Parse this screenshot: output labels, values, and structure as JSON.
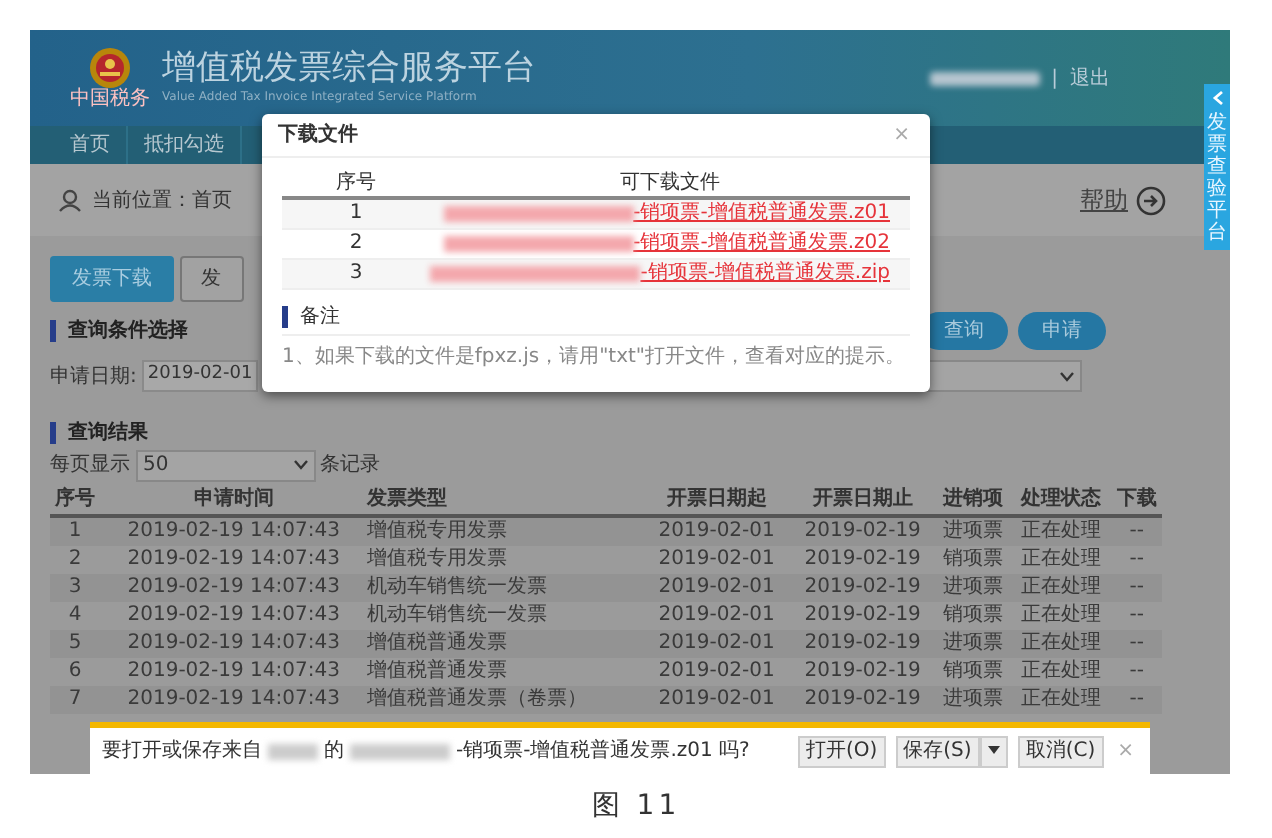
{
  "header": {
    "title": "增值税发票综合服务平台",
    "subtitle": "Value Added Tax Invoice Integrated Service Platform",
    "logo_text": "中国税务",
    "separator": "|",
    "logout": "退出"
  },
  "side_tab": {
    "label": "发票查验平台"
  },
  "nav": [
    {
      "label": "首页",
      "selected": false
    },
    {
      "label": "抵扣勾选",
      "selected": false
    }
  ],
  "breadcrumb": "当前位置：首页",
  "help": "帮助",
  "action_tabs": [
    {
      "label": "发票下载",
      "selected": true
    },
    {
      "label": "发",
      "selected": false
    }
  ],
  "query_section": {
    "title": "查询条件选择",
    "date_label": "申请日期:",
    "date_value": "2019-02-01",
    "buttons": [
      "查询",
      "申请"
    ]
  },
  "results": {
    "title": "查询结果",
    "page_size_label": "每页显示",
    "page_size": "50",
    "records_label": "条记录",
    "columns": [
      "序号",
      "申请时间",
      "发票类型",
      "开票日期起",
      "开票日期止",
      "进销项",
      "处理状态",
      "下载"
    ],
    "rows": [
      [
        "1",
        "2019-02-19 14:07:43",
        "增值税专用发票",
        "2019-02-01",
        "2019-02-19",
        "进项票",
        "正在处理",
        "--"
      ],
      [
        "2",
        "2019-02-19 14:07:43",
        "增值税专用发票",
        "2019-02-01",
        "2019-02-19",
        "销项票",
        "正在处理",
        "--"
      ],
      [
        "3",
        "2019-02-19 14:07:43",
        "机动车销售统一发票",
        "2019-02-01",
        "2019-02-19",
        "进项票",
        "正在处理",
        "--"
      ],
      [
        "4",
        "2019-02-19 14:07:43",
        "机动车销售统一发票",
        "2019-02-01",
        "2019-02-19",
        "销项票",
        "正在处理",
        "--"
      ],
      [
        "5",
        "2019-02-19 14:07:43",
        "增值税普通发票",
        "2019-02-01",
        "2019-02-19",
        "进项票",
        "正在处理",
        "--"
      ],
      [
        "6",
        "2019-02-19 14:07:43",
        "增值税普通发票",
        "2019-02-01",
        "2019-02-19",
        "销项票",
        "正在处理",
        "--"
      ],
      [
        "7",
        "2019-02-19 14:07:43",
        "增值税普通发票（卷票）",
        "2019-02-01",
        "2019-02-19",
        "进项票",
        "正在处理",
        "--"
      ]
    ]
  },
  "modal": {
    "title": "下载文件",
    "close": "×",
    "columns": [
      "序号",
      "可下载文件"
    ],
    "files": [
      {
        "index": "1",
        "name": "-销项票-增值税普通发票.z01"
      },
      {
        "index": "2",
        "name": "-销项票-增值税普通发票.z02"
      },
      {
        "index": "3",
        "name": "-销项票-增值税普通发票.zip"
      }
    ],
    "notes_title": "备注",
    "notes": [
      "1、如果下载的文件是fpxz.js，请用\"txt\"打开文件，查看对应的提示。"
    ]
  },
  "download_bar": {
    "message_start": "要打开或保存来自",
    "message_mid": "的",
    "message_end": "-销项票-增值税普通发票.z01 吗?",
    "buttons": [
      {
        "label": "打开(O)",
        "kind": "plain"
      },
      {
        "label": "保存(S)",
        "kind": "split"
      },
      {
        "label": "取消(C)",
        "kind": "plain"
      }
    ],
    "close": "×"
  },
  "caption": "图 11"
}
